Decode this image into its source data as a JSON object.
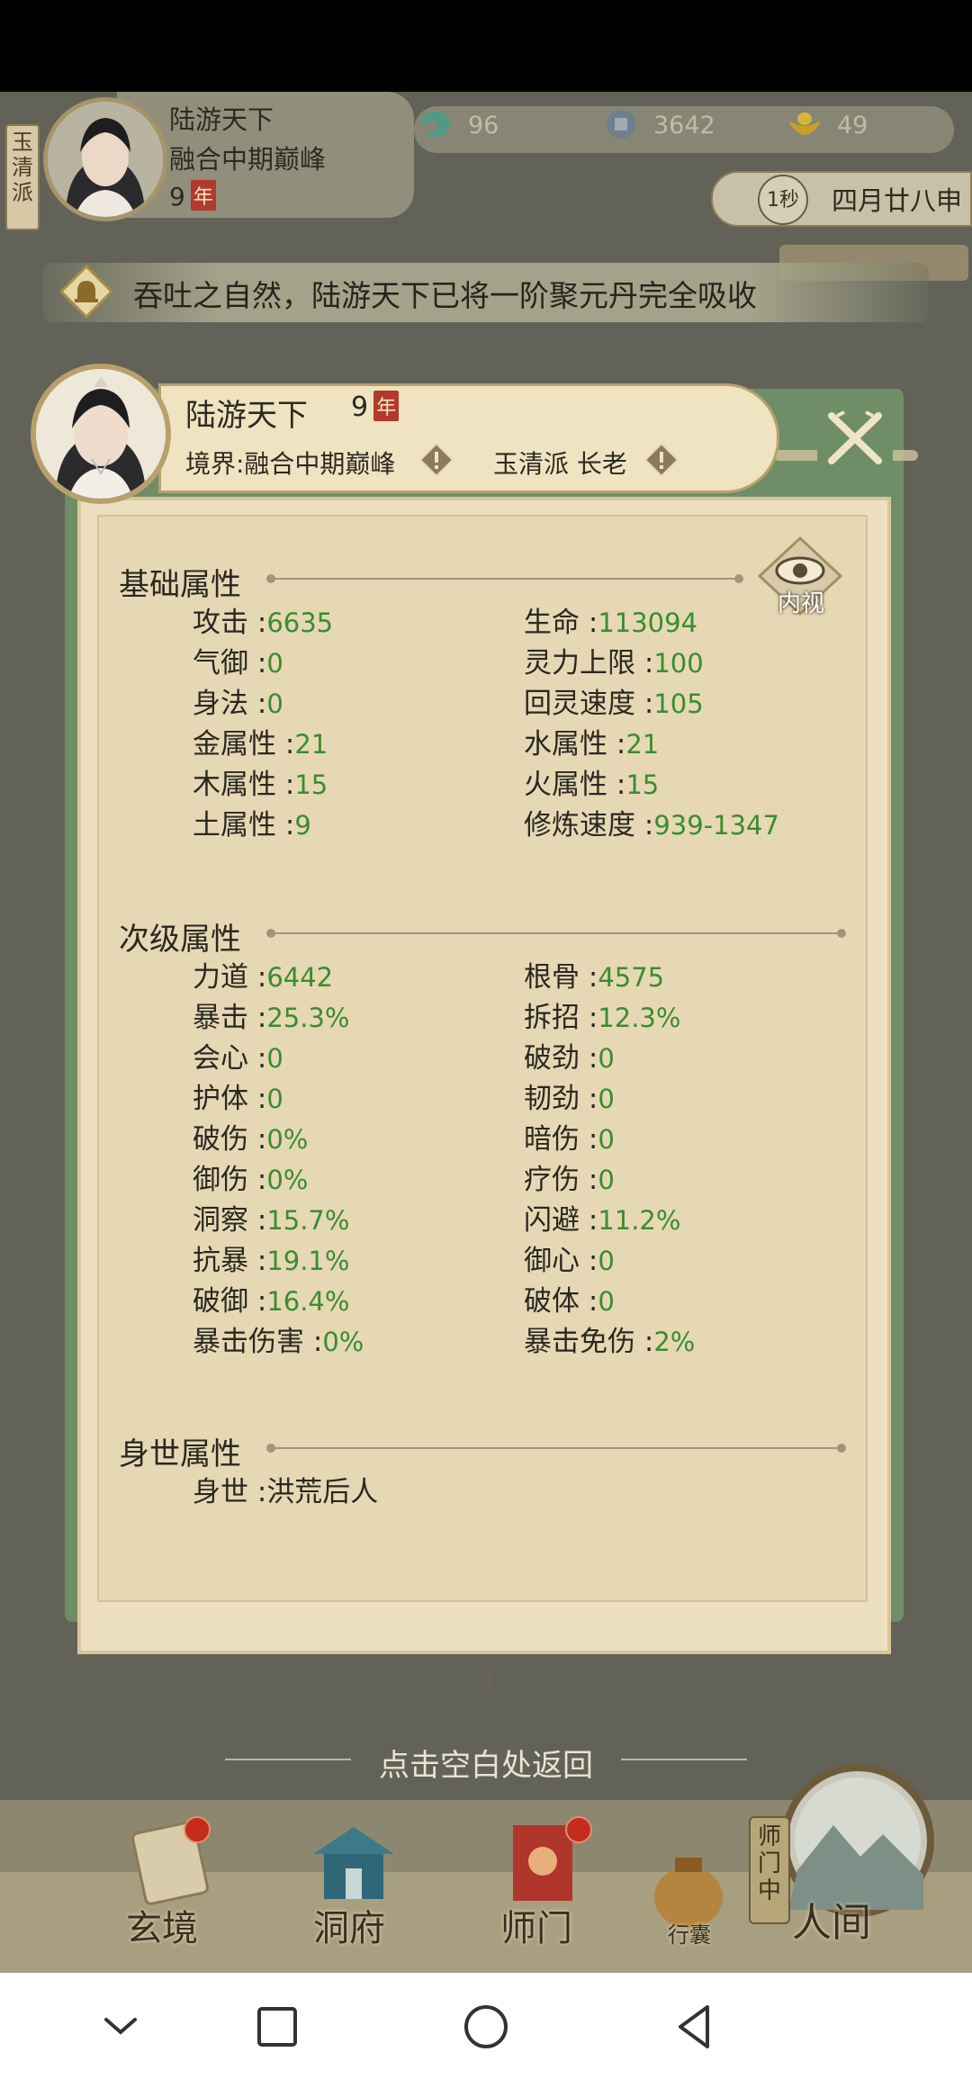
{
  "hud": {
    "sect_tag": "玉清派",
    "name": "陆游天下",
    "realm": "融合中期巅峰",
    "age": "9",
    "age_unit": "年",
    "resources": [
      {
        "icon": "spirit-stone-icon",
        "value": "96"
      },
      {
        "icon": "coin-icon",
        "value": "3642"
      },
      {
        "icon": "gold-ingot-icon",
        "value": "49"
      }
    ],
    "date_icon_text": "1秒",
    "date": "四月廿八申"
  },
  "notice": {
    "text": "吞吐之自然，陆游天下已将一阶聚元丹完全吸收"
  },
  "profile": {
    "name": "陆游天下",
    "age": "9",
    "age_unit": "年",
    "realm": "境界:融合中期巅峰",
    "sect": "玉清派 长老",
    "inner_view_label": "内视"
  },
  "sections": {
    "basic_title": "基础属性",
    "secondary_title": "次级属性",
    "origin_title": "身世属性"
  },
  "basic_stats": [
    {
      "label": "攻击 :",
      "value": "6635"
    },
    {
      "label": "生命 :",
      "value": "113094"
    },
    {
      "label": "气御 :",
      "value": "0"
    },
    {
      "label": "灵力上限 :",
      "value": "100"
    },
    {
      "label": "身法 :",
      "value": "0"
    },
    {
      "label": "回灵速度 :",
      "value": "105"
    },
    {
      "label": "金属性 :",
      "value": "21"
    },
    {
      "label": "水属性 :",
      "value": "21"
    },
    {
      "label": "木属性 :",
      "value": "15"
    },
    {
      "label": "火属性 :",
      "value": "15"
    },
    {
      "label": "土属性 :",
      "value": "9"
    },
    {
      "label": "修炼速度 :",
      "value": "939-1347"
    }
  ],
  "secondary_stats": [
    {
      "label": "力道 :",
      "value": "6442"
    },
    {
      "label": "根骨 :",
      "value": "4575"
    },
    {
      "label": "暴击 :",
      "value": "25.3%"
    },
    {
      "label": "拆招 :",
      "value": "12.3%"
    },
    {
      "label": "会心 :",
      "value": "0"
    },
    {
      "label": "破劲 :",
      "value": "0"
    },
    {
      "label": "护体 :",
      "value": "0"
    },
    {
      "label": "韧劲 :",
      "value": "0"
    },
    {
      "label": "破伤 :",
      "value": "0%"
    },
    {
      "label": "暗伤 :",
      "value": "0"
    },
    {
      "label": "御伤 :",
      "value": "0%"
    },
    {
      "label": "疗伤 :",
      "value": "0"
    },
    {
      "label": "洞察 :",
      "value": "15.7%"
    },
    {
      "label": "闪避 :",
      "value": "11.2%"
    },
    {
      "label": "抗暴 :",
      "value": "19.1%"
    },
    {
      "label": "御心 :",
      "value": "0"
    },
    {
      "label": "破御 :",
      "value": "16.4%"
    },
    {
      "label": "破体 :",
      "value": "0"
    },
    {
      "label": "暴击伤害 :",
      "value": "0%"
    },
    {
      "label": "暴击免伤 :",
      "value": "2%"
    }
  ],
  "origin": {
    "label": "身世 :",
    "value": "洪荒后人"
  },
  "back_hint": "点击空白处返回",
  "nav": {
    "items": [
      "玄境",
      "洞府",
      "师门",
      "行囊",
      "人间"
    ],
    "shimen_tag": "师门中"
  },
  "colors": {
    "value_green": "#3b8c30",
    "parchment": "#ece0c0",
    "frame_green": "#6f8e67"
  }
}
